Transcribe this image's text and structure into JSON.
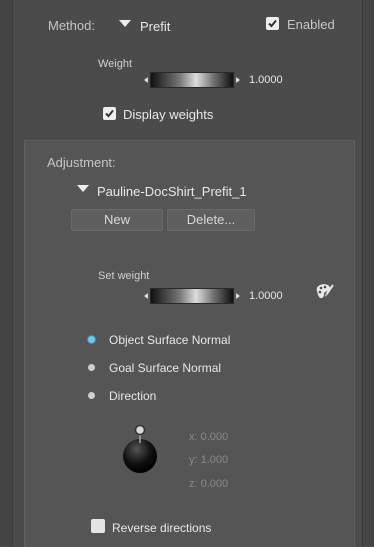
{
  "method": {
    "label": "Method:",
    "value": "Prefit",
    "enabled_label": "Enabled",
    "enabled_checked": true
  },
  "weight": {
    "label": "Weight",
    "value": "1.0000",
    "fill": 1.0
  },
  "display_weights": {
    "label": "Display weights",
    "checked": true
  },
  "adjustment": {
    "label": "Adjustment:",
    "name": "Pauline-DocShirt_Prefit_1",
    "new_label": "New",
    "delete_label": "Delete..."
  },
  "set_weight": {
    "label": "Set weight",
    "value": "1.0000",
    "fill": 1.0,
    "brush_icon": "brush-icon"
  },
  "normals": {
    "options": [
      "Object Surface Normal",
      "Goal Surface Normal",
      "Direction"
    ],
    "selected": "Object Surface Normal"
  },
  "direction": {
    "x": "x: 0.000",
    "y": "y: 1.000",
    "z": "z: 0.000"
  },
  "reverse": {
    "label": "Reverse directions",
    "checked": false
  },
  "colors": {
    "panel_bg": "#4b4b4b",
    "section_bg": "#555555",
    "radio_active": "#6ec8e6"
  }
}
